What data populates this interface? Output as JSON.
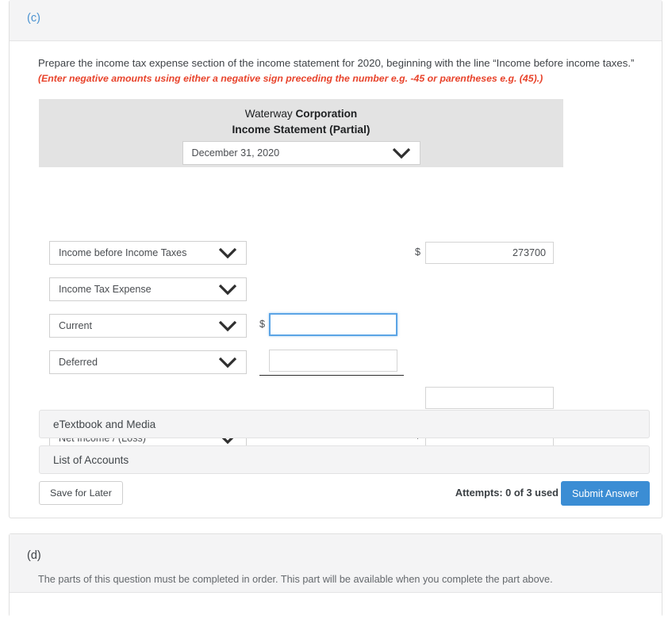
{
  "part_c": {
    "letter": "(c)",
    "instruction": "Prepare the income tax expense section of the income statement for 2020, beginning with the line “Income before income taxes.”",
    "note": "(Enter negative amounts using either a negative sign preceding the number e.g. -45 or parentheses e.g. (45).)",
    "statement": {
      "company_prefix": "Waterway ",
      "company_suffix": "Corporation",
      "title": "Income Statement (Partial)",
      "date_select": {
        "value": "December 31, 2020",
        "icon": "chevron-down-icon"
      },
      "rows": [
        {
          "account": "Income before Income Taxes",
          "mid_dollar": "",
          "mid_value": "",
          "right_dollar": "$",
          "right_value": "273700"
        },
        {
          "account": "Income Tax Expense",
          "mid_dollar": "",
          "mid_value": "",
          "right_dollar": "",
          "right_value": ""
        },
        {
          "account": "Current",
          "mid_dollar": "$",
          "mid_value": "",
          "right_dollar": "",
          "right_value": ""
        },
        {
          "account": "Deferred",
          "mid_dollar": "",
          "mid_value": "",
          "right_dollar": "",
          "right_value": ""
        },
        {
          "account": "Net Income / (Loss)",
          "mid_dollar": "",
          "mid_value": "",
          "right_dollar": "$",
          "right_value": ""
        }
      ],
      "subtotal_value": ""
    },
    "accordions": [
      {
        "label": "eTextbook and Media"
      },
      {
        "label": "List of Accounts"
      }
    ],
    "footer": {
      "save_label": "Save for Later",
      "attempts": "Attempts: 0 of 3 used",
      "submit_label": "Submit Answer"
    }
  },
  "part_d": {
    "letter": "(d)",
    "note": "The parts of this question must be completed in order. This part will be available when you complete the part above."
  },
  "colors": {
    "accent_blue": "#3b8dd4",
    "part_letter_blue": "#4b93d1",
    "note_red": "#e8432b",
    "statement_header_gray": "#e3e3e3",
    "focus_blue": "#5ba4e5"
  }
}
